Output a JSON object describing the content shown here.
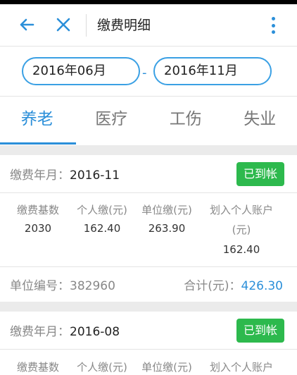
{
  "header": {
    "title": "缴费明细"
  },
  "date_range": {
    "start": "2016年06月",
    "separator": "-",
    "end": "2016年11月"
  },
  "tabs": [
    {
      "label": "养老",
      "active": true
    },
    {
      "label": "医疗",
      "active": false
    },
    {
      "label": "工伤",
      "active": false
    },
    {
      "label": "失业",
      "active": false
    }
  ],
  "columns": {
    "base": "缴费基数",
    "personal": "个人缴(元)",
    "unit": "单位缴(元)",
    "account_line1": "划入个人账户",
    "account_line2": "(元)"
  },
  "records": [
    {
      "month_label": "缴费年月：",
      "month": "2016-11",
      "status": "已到帐",
      "base": "2030",
      "personal": "162.40",
      "unit": "263.90",
      "account": "162.40",
      "unit_no_label": "单位编号：",
      "unit_no": "382960",
      "total_label": "合计(元)：",
      "total": "426.30"
    },
    {
      "month_label": "缴费年月：",
      "month": "2016-08",
      "status": "已到帐"
    }
  ],
  "colors": {
    "accent": "#2b8fd9",
    "status_green": "#2db94d"
  }
}
